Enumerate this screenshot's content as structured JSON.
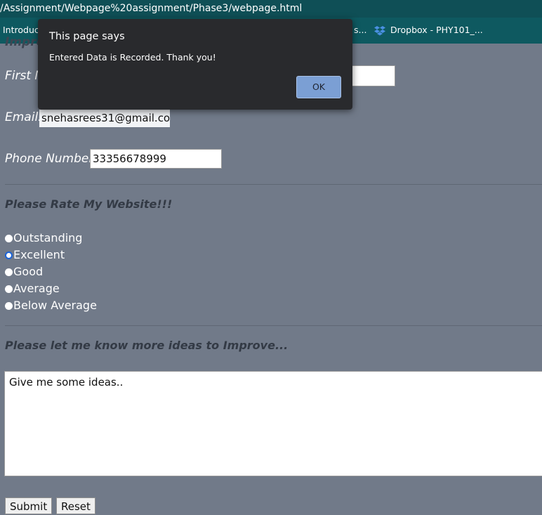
{
  "browser": {
    "url": "/Assignment/Webpage%20assignment/Phase3/webpage.html",
    "bookmarks": [
      {
        "label": "Introduct"
      },
      {
        "label": "s..."
      },
      {
        "label": "Dropbox - PHY101_...",
        "icon": "dropbox-icon"
      }
    ]
  },
  "page": {
    "section_heading_partial": "Impro",
    "first_name_label_partial": "First N",
    "email_label": "Email:",
    "email_value": "snehasrees31@gmail.co",
    "phone_label": "Phone Number:",
    "phone_value": "33356678999",
    "rate_title": "Please Rate My Website!!!",
    "rating_options": [
      "Outstanding",
      "Excellent",
      "Good",
      "Average",
      "Below Average"
    ],
    "rating_selected": "Excellent",
    "ideas_title": "Please let me know more ideas to Improve...",
    "ideas_placeholder": "Give me some ideas..",
    "submit_label": "Submit",
    "reset_label": "Reset"
  },
  "dialog": {
    "title": "This page says",
    "message": "Entered Data is Recorded. Thank you!",
    "ok_label": "OK"
  },
  "colors": {
    "page_background": "#717a89",
    "toolbar": "#0e5960",
    "dialog_background": "#292a2d",
    "ok_button": "#7b9fd4",
    "radio_focus": "#1a63d8"
  }
}
